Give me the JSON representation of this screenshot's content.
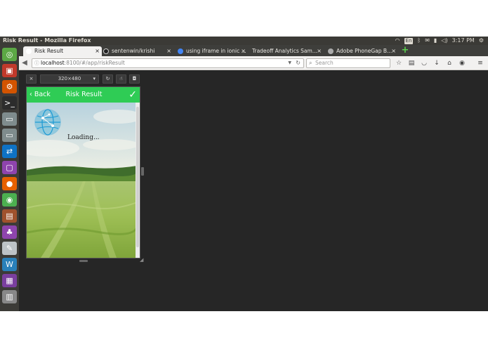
{
  "topbar": {
    "window_title": "Risk Result - Mozilla Firefox",
    "keyboard_layout": "En",
    "time": "3:17 PM"
  },
  "tabs": [
    {
      "title": "Risk Result",
      "active": true
    },
    {
      "title": "sentenwin/krishi",
      "active": false
    },
    {
      "title": "using iframe in ionic ...",
      "active": false
    },
    {
      "title": "Tradeoff Analytics Sam...",
      "active": false
    },
    {
      "title": "Adobe PhoneGap B...",
      "active": false
    }
  ],
  "urlbar": {
    "host": "localhost",
    "path": ":8100/#/app/riskResult"
  },
  "search": {
    "placeholder": "Search"
  },
  "responsive": {
    "close_label": "×",
    "size_label": "320×480",
    "size_caret": "▾"
  },
  "app": {
    "back_label": "Back",
    "header_title": "Risk Result",
    "loading_text": "Loading..."
  },
  "colors": {
    "header_green": "#2fcc55",
    "desktop_bg": "#262626",
    "launcher_bg": "#3c3b37"
  },
  "launcher_icons": [
    {
      "name": "dash",
      "color": "#5ca845"
    },
    {
      "name": "files",
      "color": "#c0392b"
    },
    {
      "name": "settings",
      "color": "#d35400"
    },
    {
      "name": "terminal",
      "color": "#2c2c2c"
    },
    {
      "name": "drive-1",
      "color": "#7f8c8d"
    },
    {
      "name": "drive-2",
      "color": "#7f8c8d"
    },
    {
      "name": "teamviewer",
      "color": "#0e72c5"
    },
    {
      "name": "vm",
      "color": "#8e44ad"
    },
    {
      "name": "firefox",
      "color": "#e66000"
    },
    {
      "name": "chrome",
      "color": "#4caf50"
    },
    {
      "name": "archive",
      "color": "#a0522d"
    },
    {
      "name": "games",
      "color": "#8e44ad"
    },
    {
      "name": "text-editor",
      "color": "#bdc3c7"
    },
    {
      "name": "writer",
      "color": "#2980b9"
    },
    {
      "name": "impress",
      "color": "#7a3f9e"
    },
    {
      "name": "trash",
      "color": "#888888"
    }
  ]
}
